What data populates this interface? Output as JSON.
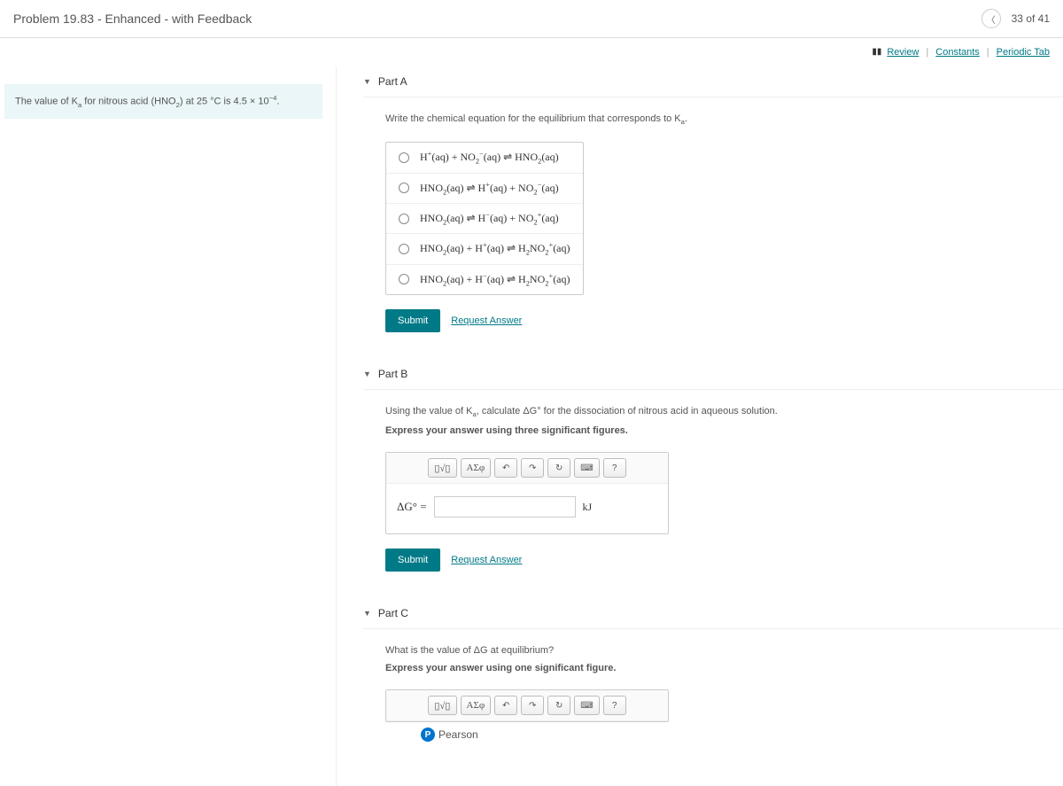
{
  "header": {
    "title": "Problem 19.83 - Enhanced - with Feedback",
    "page_indicator": "33 of 41"
  },
  "links": {
    "review": "Review",
    "constants": "Constants",
    "periodic": "Periodic Tab"
  },
  "sidebar": {
    "info_html": "The value of K<sub>a</sub> for nitrous acid (HNO<sub>2</sub>) at 25 °C is 4.5 × 10<sup>−4</sup>."
  },
  "partA": {
    "title": "Part A",
    "instruction": "Write the chemical equation for the equilibrium that corresponds to K<sub>a</sub>.",
    "options": [
      "H<sup>+</sup>(aq) + NO<sub>2</sub><sup>−</sup>(aq) ⇌ HNO<sub>2</sub>(aq)",
      "HNO<sub>2</sub>(aq) ⇌ H<sup>+</sup>(aq) + NO<sub>2</sub><sup>−</sup>(aq)",
      "HNO<sub>2</sub>(aq) ⇌ H<sup>−</sup>(aq) + NO<sub>2</sub><sup>+</sup>(aq)",
      "HNO<sub>2</sub>(aq) + H<sup>+</sup>(aq) ⇌ H<sub>2</sub>NO<sub>2</sub><sup>+</sup>(aq)",
      "HNO<sub>2</sub>(aq) + H<sup>−</sup>(aq) ⇌ H<sub>2</sub>NO<sub>2</sub><sup>+</sup>(aq)"
    ],
    "submit": "Submit",
    "request": "Request Answer"
  },
  "partB": {
    "title": "Part B",
    "instruction1": "Using the value of K<sub>a</sub>, calculate ΔG° for the dissociation of nitrous acid in aqueous solution.",
    "instruction2": "Express your answer using three significant figures.",
    "var_label": "ΔG° =",
    "unit": "kJ",
    "toolbar": {
      "templ": "▯√▯",
      "sym": "ΑΣφ",
      "undo": "↶",
      "redo": "↷",
      "reset": "↻",
      "keyboard": "⌨",
      "help": "?"
    },
    "submit": "Submit",
    "request": "Request Answer"
  },
  "partC": {
    "title": "Part C",
    "instruction1": "What is the value of ΔG at equilibrium?",
    "instruction2": "Express your answer using one significant figure.",
    "toolbar": {
      "templ": "▯√▯",
      "sym": "ΑΣφ",
      "undo": "↶",
      "redo": "↷",
      "reset": "↻",
      "keyboard": "⌨",
      "help": "?"
    }
  },
  "footer": {
    "brand": "Pearson"
  }
}
